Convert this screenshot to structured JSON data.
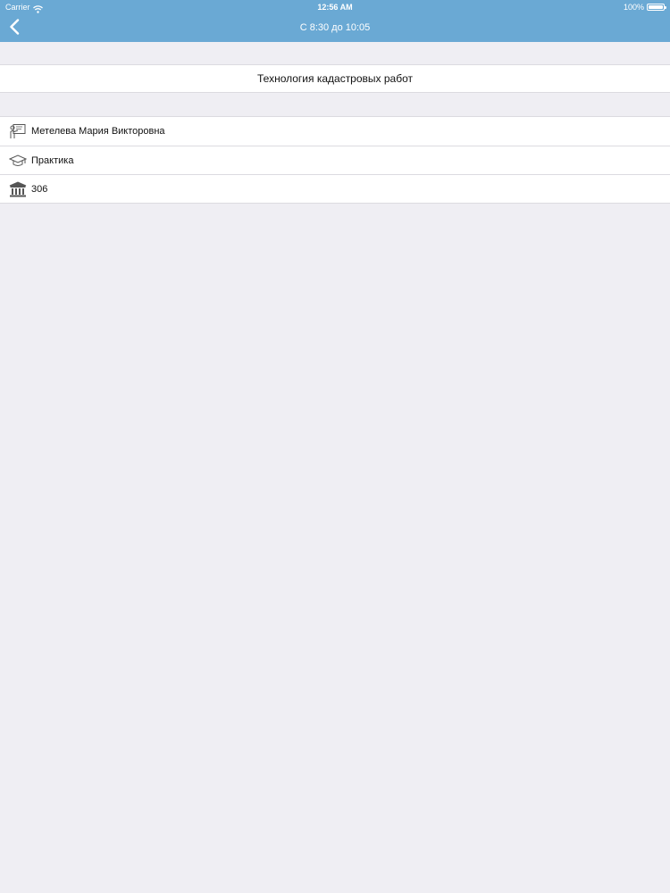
{
  "status_bar": {
    "carrier": "Carrier",
    "time": "12:56 AM",
    "battery": "100%"
  },
  "nav": {
    "title": "С 8:30 до 10:05",
    "back_icon": "chevron-left-icon"
  },
  "lesson": {
    "title": "Технология кадастровых работ"
  },
  "details": [
    {
      "icon": "teacher-icon",
      "text": "Метелева Мария Викторовна"
    },
    {
      "icon": "graduation-cap-icon",
      "text": "Практика"
    },
    {
      "icon": "building-icon",
      "text": "306"
    }
  ],
  "colors": {
    "header": "#6aa9d4",
    "background": "#efeef3",
    "row_background": "#ffffff",
    "separator": "#dcdbe0"
  }
}
